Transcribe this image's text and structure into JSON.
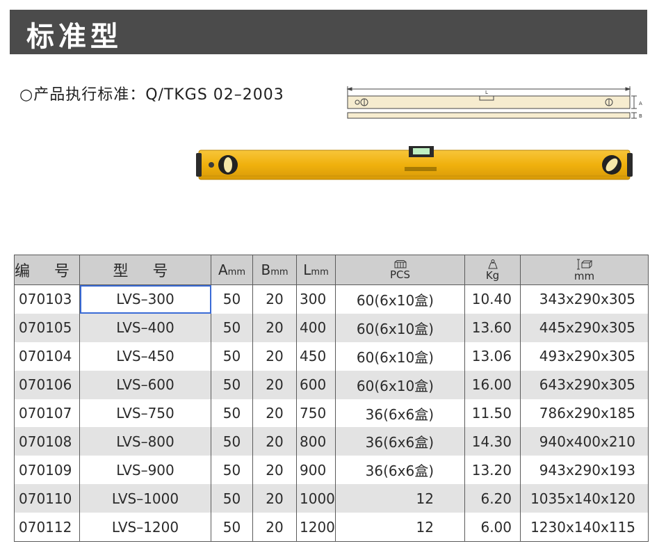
{
  "header": {
    "title": "标准型"
  },
  "standard": {
    "text": "○产品执行标准：Q/TKGS 02–2003"
  },
  "diagram": {
    "label_l": "L",
    "label_a": "A",
    "label_b": "B"
  },
  "table": {
    "columns": {
      "code": "编 号",
      "model": "型 号",
      "a": "A",
      "a_unit": "mm",
      "b": "B",
      "b_unit": "mm",
      "l": "L",
      "l_unit": "mm",
      "pcs": "PCS",
      "kg": "Kg",
      "size": "mm"
    },
    "rows": [
      {
        "code": "070103",
        "model": "LVS–300",
        "a": "50",
        "b": "20",
        "l": "300",
        "pcs": "60(6x10盒)",
        "kg": "10.40",
        "size": "343x290x305"
      },
      {
        "code": "070105",
        "model": "LVS–400",
        "a": "50",
        "b": "20",
        "l": "400",
        "pcs": "60(6x10盒)",
        "kg": "13.60",
        "size": "445x290x305"
      },
      {
        "code": "070104",
        "model": "LVS–450",
        "a": "50",
        "b": "20",
        "l": "450",
        "pcs": "60(6x10盒)",
        "kg": "13.06",
        "size": "493x290x305"
      },
      {
        "code": "070106",
        "model": "LVS–600",
        "a": "50",
        "b": "20",
        "l": "600",
        "pcs": "60(6x10盒)",
        "kg": "16.00",
        "size": "643x290x305"
      },
      {
        "code": "070107",
        "model": "LVS–750",
        "a": "50",
        "b": "20",
        "l": "750",
        "pcs": "36(6x6盒)",
        "kg": "11.50",
        "size": "786x290x185"
      },
      {
        "code": "070108",
        "model": "LVS–800",
        "a": "50",
        "b": "20",
        "l": "800",
        "pcs": "36(6x6盒)",
        "kg": "14.30",
        "size": "940x400x210"
      },
      {
        "code": "070109",
        "model": "LVS–900",
        "a": "50",
        "b": "20",
        "l": "900",
        "pcs": "36(6x6盒)",
        "kg": "13.20",
        "size": "943x290x193"
      },
      {
        "code": "070110",
        "model": "LVS–1000",
        "a": "50",
        "b": "20",
        "l": "1000",
        "pcs": "12",
        "kg": "6.20",
        "size": "1035x140x120"
      },
      {
        "code": "070112",
        "model": "LVS–1200",
        "a": "50",
        "b": "20",
        "l": "1200",
        "pcs": "12",
        "kg": "6.00",
        "size": "1230x140x115"
      }
    ]
  },
  "colors": {
    "title_bg": "#4b4b4b",
    "level_yellow": "#f2b614",
    "header_bg": "#cfcfcf",
    "stripe": "#e3e3e3",
    "selection": "#3a6bd6"
  },
  "icons": {
    "pcs": "box-stack-icon",
    "kg": "weight-icon",
    "size": "carton-dimension-icon"
  }
}
